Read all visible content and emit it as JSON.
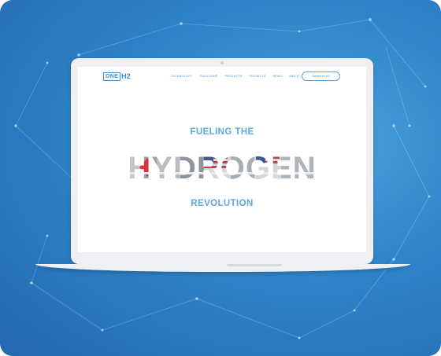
{
  "site": {
    "logo": {
      "boxed": "ONE",
      "text": "H2"
    },
    "nav_items": [
      "TECHNOLOGY",
      "SOLUTIONS",
      "PRODUCTS",
      "PROJECTS",
      "NEWS",
      "ABOUT"
    ],
    "switch_button": "Switch to H2"
  },
  "hero": {
    "line1": "FUELING THE",
    "word": "HYDROGEN",
    "line2": "REVOLUTION"
  },
  "colors": {
    "background": "#2f84c9",
    "accent": "#3f8fd0",
    "headline": "#5da9df"
  }
}
